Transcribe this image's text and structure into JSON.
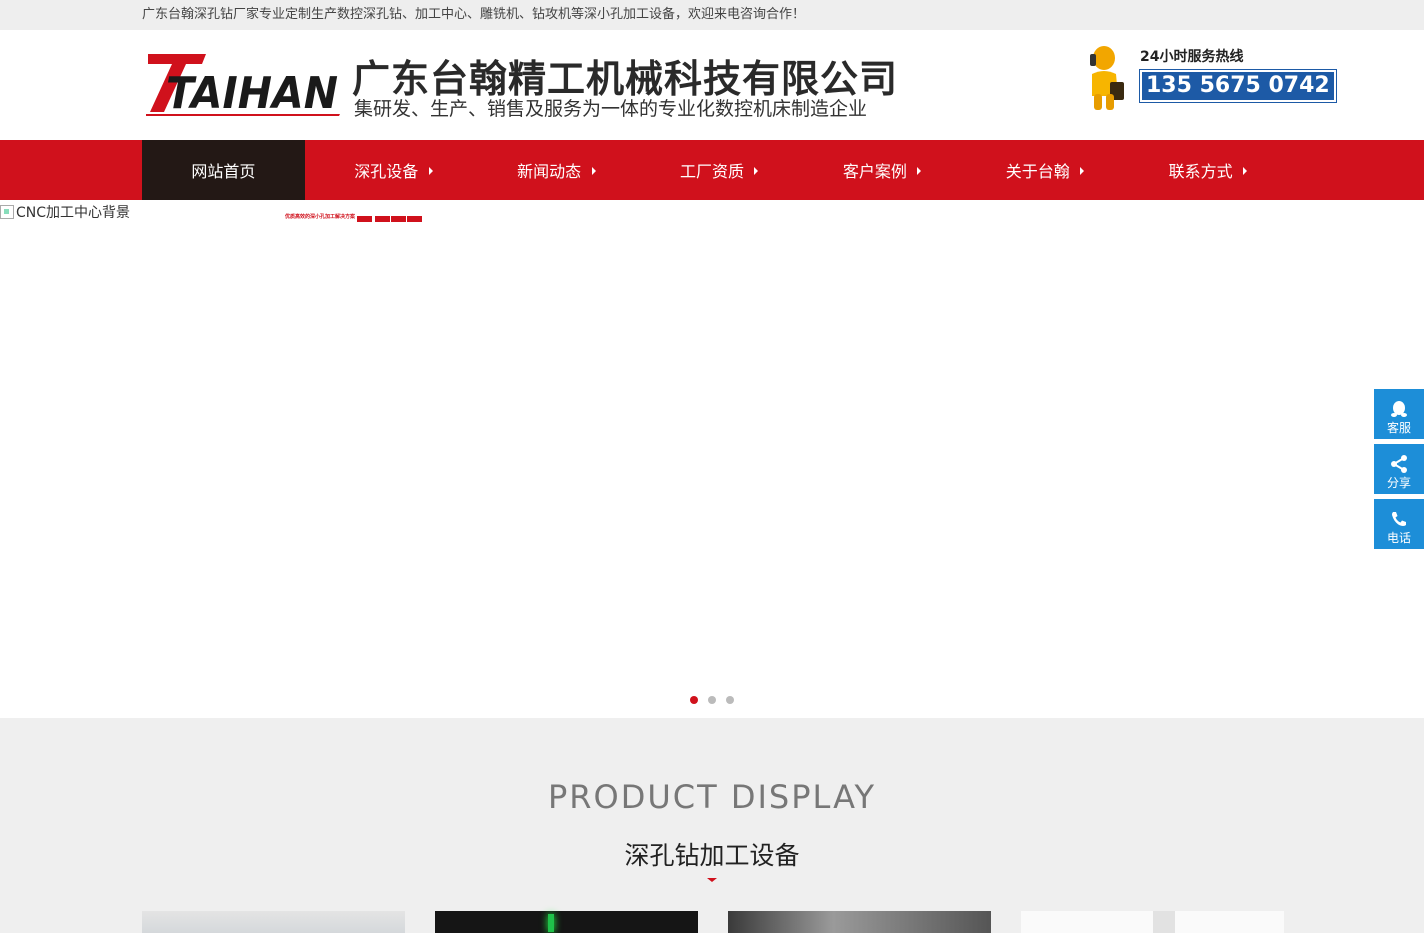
{
  "topbar": {
    "notice": "广东台翰深孔钻厂家专业定制生产数控深孔钻、加工中心、雕铣机、钻攻机等深小孔加工设备，欢迎来电咨询合作！"
  },
  "header": {
    "logo_text": "TAIHAN",
    "company_name": "广东台翰精工机械科技有限公司",
    "slogan": "集研发、生产、销售及服务为一体的专业化数控机床制造企业",
    "hotline_label": "24小时服务热线",
    "hotline_number": "135 5675 0742"
  },
  "nav": {
    "items": [
      {
        "label": "网站首页"
      },
      {
        "label": "深孔设备"
      },
      {
        "label": "新闻动态"
      },
      {
        "label": "工厂资质"
      },
      {
        "label": "客户案例"
      },
      {
        "label": "关于台翰"
      },
      {
        "label": "联系方式"
      }
    ]
  },
  "banner": {
    "alt_text": "CNC加工中心背景",
    "mini_title": "优质高效的深小孔加工解决方案",
    "slides_active": 1
  },
  "products": {
    "title_en": "PRODUCT DISPLAY",
    "title_zh": "深孔钻加工设备"
  },
  "float_panel": {
    "service": "客服",
    "share": "分享",
    "phone": "电话"
  },
  "colors": {
    "brand_red": "#d0111c",
    "nav_active": "#231815",
    "float_blue": "#1d8ed8",
    "hotline_blue": "#1d5aa6"
  }
}
